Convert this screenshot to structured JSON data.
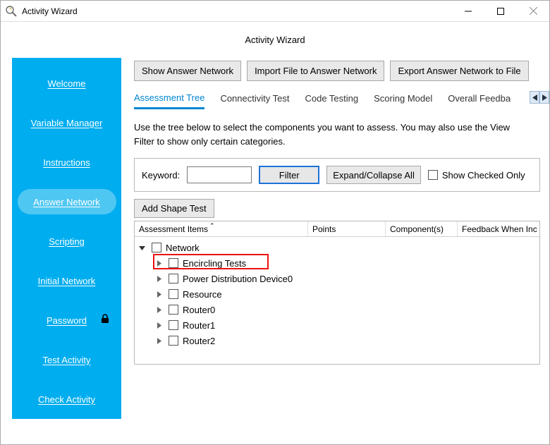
{
  "window": {
    "title": "Activity Wizard",
    "page_heading": "Activity Wizard"
  },
  "sidebar": {
    "items": [
      {
        "label": "Welcome"
      },
      {
        "label": "Variable Manager"
      },
      {
        "label": "Instructions"
      },
      {
        "label": "Answer Network",
        "active": true
      },
      {
        "label": "Scripting"
      },
      {
        "label": "Initial Network"
      },
      {
        "label": "Password",
        "locked": true
      },
      {
        "label": "Test Activity"
      },
      {
        "label": "Check Activity"
      }
    ]
  },
  "toolbar": {
    "show_answer": "Show Answer Network",
    "import_file": "Import File to Answer Network",
    "export_file": "Export Answer Network to File"
  },
  "tabs": [
    {
      "label": "Assessment Tree",
      "active": true
    },
    {
      "label": "Connectivity Test"
    },
    {
      "label": "Code Testing"
    },
    {
      "label": "Scoring Model"
    },
    {
      "label": "Overall Feedback"
    }
  ],
  "description": "Use the tree below to select the components you want to assess. You may also use the View Filter to show only certain categories.",
  "filter": {
    "keyword_label": "Keyword:",
    "keyword_value": "",
    "filter_btn": "Filter",
    "expand_btn": "Expand/Collapse All",
    "show_checked_label": "Show Checked Only"
  },
  "add_shape_btn": "Add Shape Test",
  "grid": {
    "columns": [
      "Assessment Items",
      "Points",
      "Component(s)",
      "Feedback When Incorrect"
    ],
    "col4_visible": "Feedback When Inc",
    "root": {
      "label": "Network",
      "children": [
        {
          "label": "Encircling Tests",
          "highlighted": true
        },
        {
          "label": "Power Distribution Device0"
        },
        {
          "label": "Resource"
        },
        {
          "label": "Router0"
        },
        {
          "label": "Router1"
        },
        {
          "label": "Router2"
        }
      ]
    }
  }
}
